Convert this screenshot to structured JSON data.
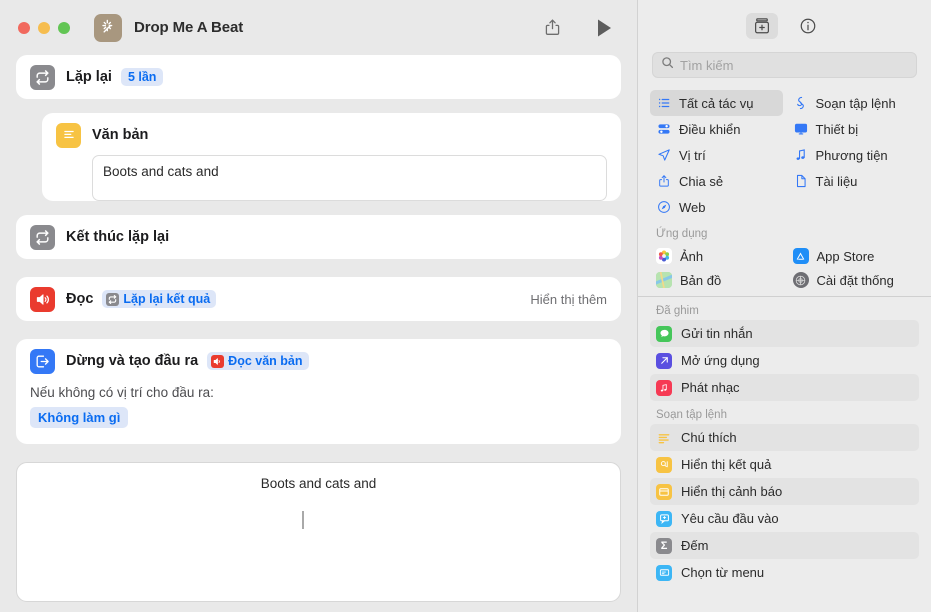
{
  "window": {
    "title": "Drop Me A Beat",
    "app_icon": "wand-sparkles-icon",
    "traffic_lights": [
      "close",
      "minimize",
      "zoom"
    ],
    "share_icon": "share-icon",
    "play_icon": "play-icon"
  },
  "editor": {
    "actions": [
      {
        "id": "repeat",
        "icon": "repeat-icon",
        "icon_color": "#8a8a8e",
        "label": "Lặp lại",
        "token": {
          "text": "5 lần",
          "style": "plain"
        }
      },
      {
        "id": "text",
        "icon": "text-icon",
        "icon_color": "#f7c343",
        "label": "Văn bản",
        "field_value": "Boots and cats and"
      },
      {
        "id": "end-repeat",
        "icon": "repeat-icon",
        "icon_color": "#8a8a8e",
        "label": "Kết thúc lặp lại"
      },
      {
        "id": "speak",
        "icon": "speaker-icon",
        "icon_color": "#ea3b2e",
        "label": "Đọc",
        "token": {
          "text": "Lặp lại kết quả",
          "icon": "repeat-icon",
          "icon_color": "gray"
        },
        "show_more": "Hiển thị thêm"
      },
      {
        "id": "stop-and-output",
        "icon": "exit-box-icon",
        "icon_color": "#3478f6",
        "label": "Dừng và tạo đầu ra",
        "token": {
          "text": "Đọc văn bản",
          "icon": "speaker-icon",
          "icon_color": "red"
        },
        "sub_line": "Nếu không có vị trí cho đầu ra:",
        "pill": "Không làm gì"
      }
    ],
    "result_preview": "Boots and cats and"
  },
  "panel": {
    "toolbar": {
      "library_icon": "action-library-icon",
      "info_icon": "info-circle-icon"
    },
    "search": {
      "placeholder": "Tìm kiếm",
      "value": "",
      "icon": "search-icon"
    },
    "categories": [
      {
        "label": "Tất cả tác vụ",
        "icon": "list-bullet-icon",
        "selected": true
      },
      {
        "label": "Soạn tập lệnh",
        "icon": "scripting-icon",
        "selected": false
      },
      {
        "label": "Điều khiển",
        "icon": "sliders-icon",
        "selected": false
      },
      {
        "label": "Thiết bị",
        "icon": "display-icon",
        "selected": false
      },
      {
        "label": "Vị trí",
        "icon": "location-arrow-icon",
        "selected": false
      },
      {
        "label": "Phương tiện",
        "icon": "music-note-icon",
        "selected": false
      },
      {
        "label": "Chia sẻ",
        "icon": "share-icon",
        "selected": false
      },
      {
        "label": "Tài liệu",
        "icon": "document-icon",
        "selected": false
      },
      {
        "label": "Web",
        "icon": "safari-compass-icon",
        "selected": false
      }
    ],
    "sections": [
      {
        "title": "Ứng dụng",
        "layout": "grid",
        "items": [
          {
            "label": "Ảnh",
            "icon": "photos-app-icon",
            "color": "#ffffff"
          },
          {
            "label": "App Store",
            "icon": "app-store-icon",
            "color": "#1f8ef7"
          },
          {
            "label": "Bản đồ",
            "icon": "maps-app-icon",
            "color": "#9fd8a8"
          },
          {
            "label": "Cài đặt  thống",
            "icon": "system-settings-icon",
            "color": "#6e6e73"
          }
        ]
      },
      {
        "title": "Đã ghim",
        "layout": "list",
        "items": [
          {
            "label": "Gửi tin nhắn",
            "icon": "messages-icon",
            "color": "#45c65a",
            "alt": true
          },
          {
            "label": "Mở ứng dụng",
            "icon": "open-app-icon",
            "color": "#5a4fe0",
            "alt": false
          },
          {
            "label": "Phát nhạc",
            "icon": "music-icon",
            "color": "#f63a54",
            "alt": true
          }
        ]
      },
      {
        "title": "Soạn tập lệnh",
        "layout": "list",
        "items": [
          {
            "label": "Chú thích",
            "icon": "comment-lines-icon",
            "color": "#f7c343",
            "alt": true
          },
          {
            "label": "Hiển thị kết quả",
            "icon": "show-result-icon",
            "color": "#f7c343",
            "alt": false
          },
          {
            "label": "Hiển thị cảnh báo",
            "icon": "show-alert-icon",
            "color": "#f7c343",
            "alt": true
          },
          {
            "label": "Yêu cầu đầu vào",
            "icon": "ask-input-icon",
            "color": "#3cb6f5",
            "alt": false
          },
          {
            "label": "Đếm",
            "icon": "sigma-count-icon",
            "color": "#8a8a8e",
            "alt": true
          },
          {
            "label": "Chọn từ menu",
            "icon": "choose-menu-icon",
            "color": "#3cb6f5",
            "alt": false
          }
        ]
      }
    ]
  }
}
